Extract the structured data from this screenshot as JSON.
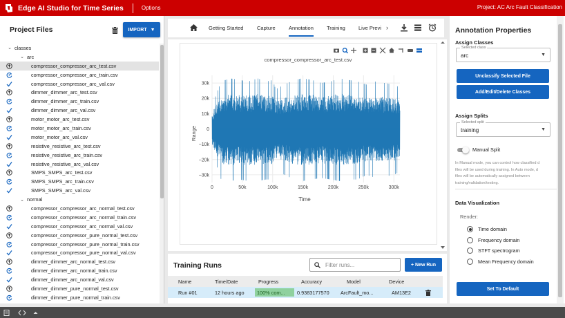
{
  "app": {
    "title": "Edge AI Studio for Time Series",
    "options_label": "Options",
    "project_label": "Project: AC Arc Fault Classification"
  },
  "colors": {
    "brand": "#cc0000",
    "accent": "#1565c0",
    "trace": "#1f77b4"
  },
  "left_panel": {
    "title": "Project Files",
    "import_label": "IMPORT",
    "tree": [
      {
        "label": "classes",
        "level": 0,
        "type": "folder",
        "expanded": true
      },
      {
        "label": "arc",
        "level": 1,
        "type": "folder",
        "expanded": true
      },
      {
        "label": "compressor_compressor_arc_test.csv",
        "level": 2,
        "type": "file",
        "icon": "upload-icon",
        "selected": true
      },
      {
        "label": "compressor_compressor_arc_train.csv",
        "level": 2,
        "type": "file",
        "icon": "refresh-icon"
      },
      {
        "label": "compressor_compressor_arc_val.csv",
        "level": 2,
        "type": "file",
        "icon": "check-icon"
      },
      {
        "label": "dimmer_dimmer_arc_test.csv",
        "level": 2,
        "type": "file",
        "icon": "upload-icon"
      },
      {
        "label": "dimmer_dimmer_arc_train.csv",
        "level": 2,
        "type": "file",
        "icon": "refresh-icon"
      },
      {
        "label": "dimmer_dimmer_arc_val.csv",
        "level": 2,
        "type": "file",
        "icon": "check-icon"
      },
      {
        "label": "motor_motor_arc_test.csv",
        "level": 2,
        "type": "file",
        "icon": "upload-icon"
      },
      {
        "label": "motor_motor_arc_train.csv",
        "level": 2,
        "type": "file",
        "icon": "refresh-icon"
      },
      {
        "label": "motor_motor_arc_val.csv",
        "level": 2,
        "type": "file",
        "icon": "check-icon"
      },
      {
        "label": "resistive_resistive_arc_test.csv",
        "level": 2,
        "type": "file",
        "icon": "upload-icon"
      },
      {
        "label": "resistive_resistive_arc_train.csv",
        "level": 2,
        "type": "file",
        "icon": "refresh-icon"
      },
      {
        "label": "resistive_resistive_arc_val.csv",
        "level": 2,
        "type": "file",
        "icon": "check-icon"
      },
      {
        "label": "SMPS_SMPS_arc_test.csv",
        "level": 2,
        "type": "file",
        "icon": "upload-icon"
      },
      {
        "label": "SMPS_SMPS_arc_train.csv",
        "level": 2,
        "type": "file",
        "icon": "refresh-icon"
      },
      {
        "label": "SMPS_SMPS_arc_val.csv",
        "level": 2,
        "type": "file",
        "icon": "check-icon"
      },
      {
        "label": "normal",
        "level": 1,
        "type": "folder",
        "expanded": true
      },
      {
        "label": "compressor_compressor_arc_normal_test.csv",
        "level": 2,
        "type": "file",
        "icon": "upload-icon"
      },
      {
        "label": "compressor_compressor_arc_normal_train.csv",
        "level": 2,
        "type": "file",
        "icon": "refresh-icon"
      },
      {
        "label": "compressor_compressor_arc_normal_val.csv",
        "level": 2,
        "type": "file",
        "icon": "check-icon"
      },
      {
        "label": "compressor_compressor_pure_normal_test.csv",
        "level": 2,
        "type": "file",
        "icon": "upload-icon"
      },
      {
        "label": "compressor_compressor_pure_normal_train.csv",
        "level": 2,
        "type": "file",
        "icon": "refresh-icon"
      },
      {
        "label": "compressor_compressor_pure_normal_val.csv",
        "level": 2,
        "type": "file",
        "icon": "check-icon"
      },
      {
        "label": "dimmer_dimmer_arc_normal_test.csv",
        "level": 2,
        "type": "file",
        "icon": "upload-icon"
      },
      {
        "label": "dimmer_dimmer_arc_normal_train.csv",
        "level": 2,
        "type": "file",
        "icon": "refresh-icon"
      },
      {
        "label": "dimmer_dimmer_arc_normal_val.csv",
        "level": 2,
        "type": "file",
        "icon": "check-icon"
      },
      {
        "label": "dimmer_dimmer_pure_normal_test.csv",
        "level": 2,
        "type": "file",
        "icon": "upload-icon"
      },
      {
        "label": "dimmer_dimmer_pure_normal_train.csv",
        "level": 2,
        "type": "file",
        "icon": "refresh-icon"
      }
    ]
  },
  "tabs": [
    "Getting Started",
    "Capture",
    "Annotation",
    "Training",
    "Live Previ"
  ],
  "active_tab": "Annotation",
  "chart": {
    "title": "compressor_compressor_arc_test.csv",
    "xlabel": "Time",
    "ylabel": "Range",
    "x_ticks": [
      "0",
      "50k",
      "100k",
      "150k",
      "200k",
      "250k",
      "300k"
    ],
    "y_ticks": [
      "30k",
      "20k",
      "10k",
      "0",
      "−10k",
      "−20k",
      "−30k"
    ]
  },
  "chart_data": {
    "type": "line",
    "title": "compressor_compressor_arc_test.csv",
    "xlabel": "Time",
    "ylabel": "Range",
    "xlim": [
      0,
      310000
    ],
    "ylim": [
      -35000,
      35000
    ],
    "x_tick_values": [
      0,
      50000,
      100000,
      150000,
      200000,
      250000,
      300000
    ],
    "y_tick_values": [
      30000,
      20000,
      10000,
      0,
      -10000,
      -20000,
      -30000
    ],
    "grid": true,
    "series": [
      {
        "x": [
          0,
          15000,
          30000,
          45000,
          60000,
          75000,
          90000,
          100000,
          105000,
          120000,
          135000,
          150000,
          165000,
          180000,
          195000,
          210000,
          225000,
          240000,
          255000,
          270000,
          285000,
          300000,
          310000
        ],
        "envelope_max": [
          15000,
          31000,
          33000,
          32000,
          31000,
          33000,
          31000,
          32000,
          26000,
          29000,
          32000,
          33000,
          32000,
          30000,
          31000,
          33000,
          32000,
          31000,
          29000,
          31000,
          30000,
          29000,
          27000
        ],
        "envelope_min": [
          -15000,
          -33000,
          -34000,
          -33000,
          -34000,
          -34000,
          -33000,
          -33000,
          -27000,
          -30000,
          -33000,
          -34000,
          -33000,
          -32000,
          -33000,
          -34000,
          -33000,
          -33000,
          -30000,
          -32000,
          -31000,
          -30000,
          -28000
        ]
      }
    ]
  },
  "training_runs": {
    "title": "Training Runs",
    "filter_placeholder": "Filter runs...",
    "new_run_label": "+ New Run",
    "columns": [
      "Name",
      "Time/Date",
      "Progress",
      "Accuracy",
      "Model",
      "Device"
    ],
    "rows": [
      {
        "name": "Run #01",
        "time": "12 hours ago",
        "progress_text": "100% com...",
        "progress_value": 1.0,
        "accuracy": "0.9383177570",
        "model": "ArcFault_mo...",
        "device": "AM13E2"
      }
    ]
  },
  "right_panel": {
    "title": "Annotation Properties",
    "assign_classes": "Assign Classes",
    "class_select_label": "Selected class",
    "class_value": "arc",
    "unclassify_label": "Unclassify Selected File",
    "edit_classes_label": "Add/Edit/Delete Classes",
    "assign_splits": "Assign Splits",
    "split_select_label": "Selected split",
    "split_value": "training",
    "manual_split_label": "Manual Split",
    "desc_lines": [
      "In Manual mode, you can control how classified d",
      "files will be used during training. In Auto mode, d",
      "files will be automatically assigned between",
      "training/validation/testing."
    ],
    "data_vis": "Data Visualization",
    "render_label": "Render:",
    "render_options": [
      "Time domain",
      "Frequency domain",
      "STFT spectrogram",
      "Mean Frequency domain"
    ],
    "render_selected": 0,
    "default_label": "Set To Default"
  }
}
